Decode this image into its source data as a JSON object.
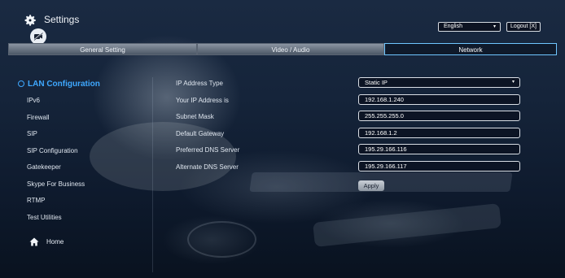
{
  "header": {
    "title": "Settings",
    "language": "English",
    "logout_label": "Logout [X]"
  },
  "tabs": [
    {
      "label": "General Setting",
      "active": false
    },
    {
      "label": "Video / Audio",
      "active": false
    },
    {
      "label": "Network",
      "active": true
    }
  ],
  "sidebar": {
    "heading": "LAN Configuration",
    "items": [
      {
        "label": "IPv6"
      },
      {
        "label": "Firewall"
      },
      {
        "label": "SIP"
      },
      {
        "label": "SIP Configuration"
      },
      {
        "label": "Gatekeeper"
      },
      {
        "label": "Skype For Business"
      },
      {
        "label": "RTMP"
      },
      {
        "label": "Test Utilities"
      }
    ],
    "home_label": "Home"
  },
  "form": {
    "fields": [
      {
        "label": "IP Address Type",
        "value": "Static IP"
      },
      {
        "label": "Your IP Address is",
        "value": "192.168.1.240"
      },
      {
        "label": "Subnet Mask",
        "value": "255.255.255.0"
      },
      {
        "label": "Default Gateway",
        "value": "192.168.1.2"
      },
      {
        "label": "Preferred DNS Server",
        "value": "195.29.166.116"
      },
      {
        "label": "Alternate DNS Server",
        "value": "195.29.166.117"
      }
    ],
    "apply_label": "Apply"
  },
  "colors": {
    "accent": "#3fa8ff",
    "active_tab_border": "#6fc6ff",
    "background": "#0b1626"
  },
  "icons": [
    "gear-icon",
    "camera-off-icon",
    "chevron-down-icon",
    "circle-dot-icon",
    "home-icon"
  ]
}
